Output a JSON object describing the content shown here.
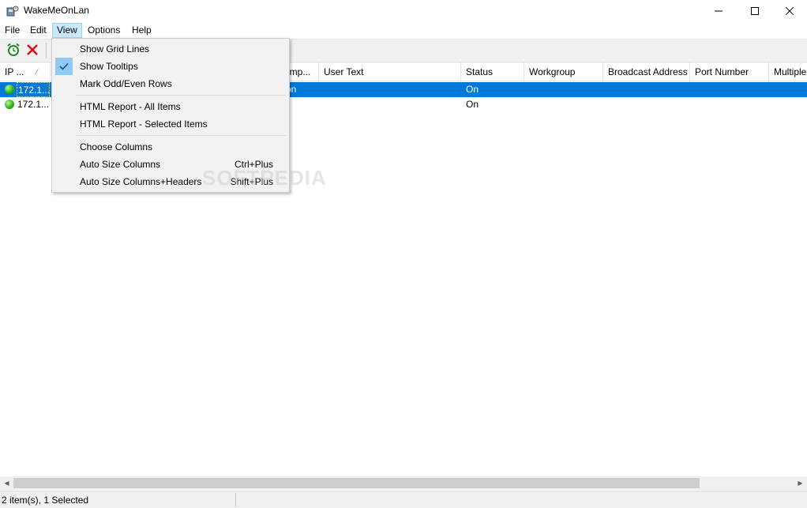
{
  "window": {
    "title": "WakeMeOnLan"
  },
  "menu": {
    "file": "File",
    "edit": "Edit",
    "view": "View",
    "options": "Options",
    "help": "Help"
  },
  "list": {
    "columns": [
      {
        "label": "IP ..."
      },
      {
        "label": "omp..."
      },
      {
        "label": "User Text"
      },
      {
        "label": "Status"
      },
      {
        "label": "Workgroup"
      },
      {
        "label": "Broadcast Address"
      },
      {
        "label": "Port Number"
      },
      {
        "label": "Multiple"
      }
    ],
    "rows": [
      {
        "ip": "172.1...",
        "computer": "on",
        "status": "On",
        "selected": true
      },
      {
        "ip": "172.1...",
        "computer": "",
        "status": "On",
        "selected": false
      }
    ]
  },
  "view_menu": {
    "show_grid_lines": "Show Grid Lines",
    "show_tooltips": "Show Tooltips",
    "mark_odd_even": "Mark Odd/Even Rows",
    "html_report_all": "HTML Report - All Items",
    "html_report_selected": "HTML Report - Selected Items",
    "choose_columns": "Choose Columns",
    "auto_size_columns": "Auto Size Columns",
    "auto_size_columns_shortcut": "Ctrl+Plus",
    "auto_size_headers": "Auto Size Columns+Headers",
    "auto_size_headers_shortcut": "Shift+Plus"
  },
  "statusbar": {
    "text": "2 item(s), 1 Selected"
  },
  "watermark": "SOFTPEDIA"
}
